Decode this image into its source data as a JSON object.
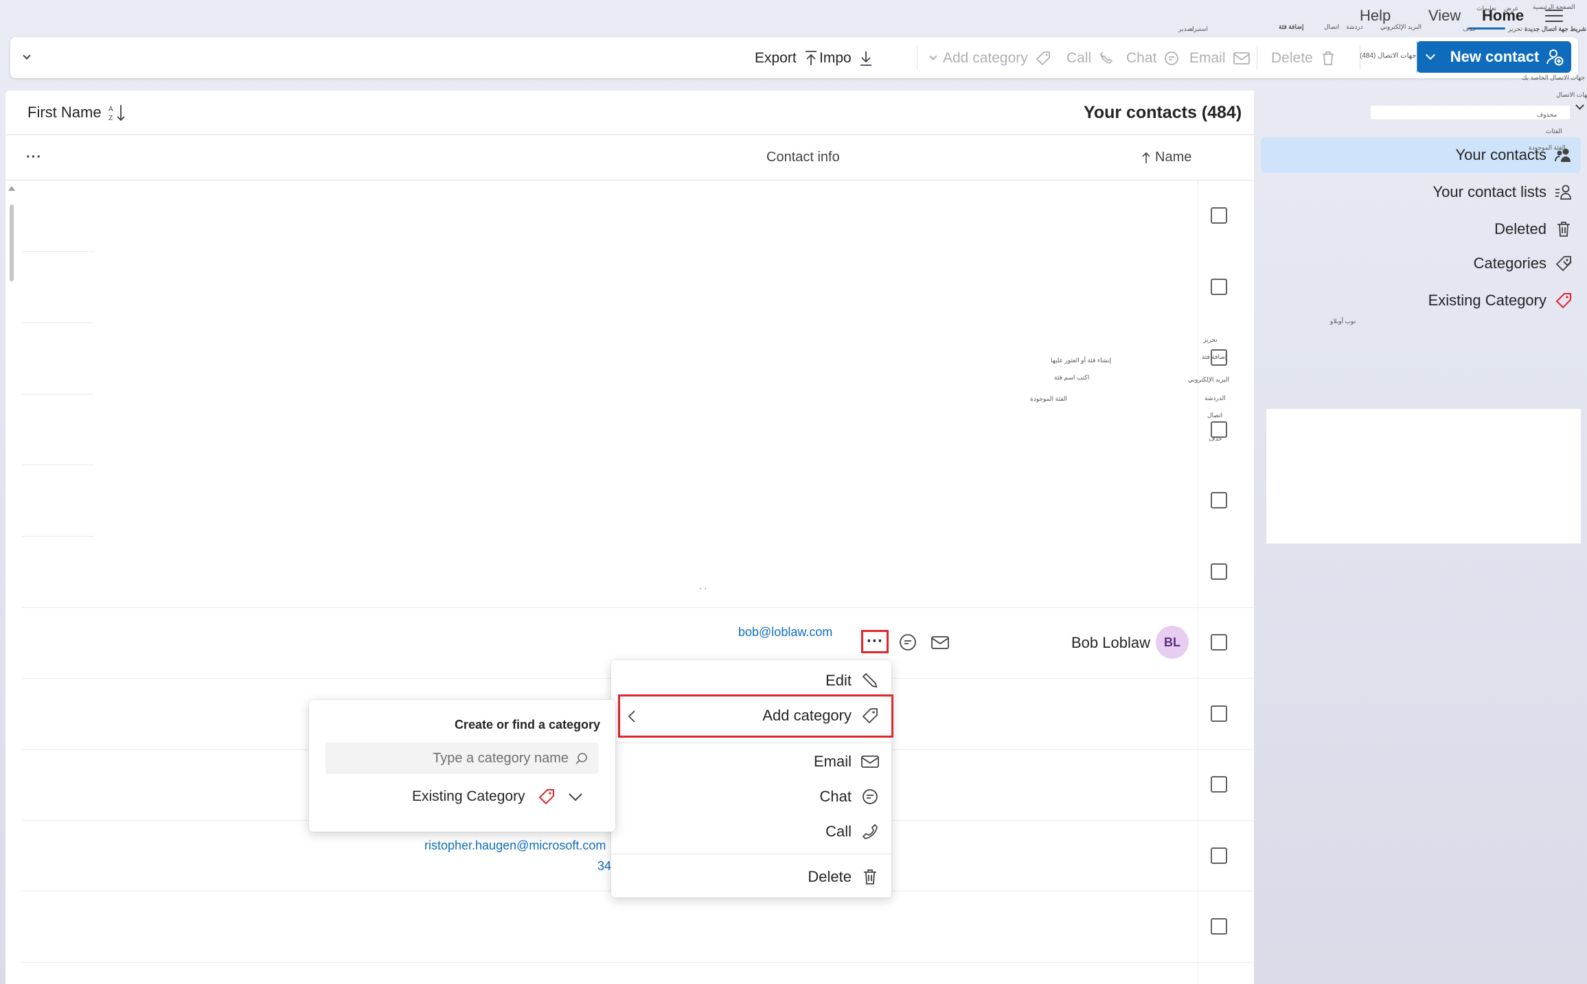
{
  "topbar": {
    "tabs": [
      {
        "label": "Home",
        "active": true
      },
      {
        "label": "View",
        "active": false
      },
      {
        "label": "Help",
        "active": false
      }
    ],
    "overlay_labels": [
      "الصفحة الرئيسية",
      "عرض",
      "تعليمات",
      "شريط جهة اتصال جديدة",
      "إضافة فئة",
      "البريد الإلكتروني",
      "دردشة",
      "اتصال",
      "استيراد",
      "تصدير",
      "تحرير",
      "حذف"
    ]
  },
  "ribbon": {
    "new_contact": "New contact",
    "contact_count_fragment": "جهات الاتصال (484)",
    "delete": "Delete",
    "email": "Email",
    "chat": "Chat",
    "call": "Call",
    "add_category": "Add category",
    "import": "Impo",
    "export": "Export"
  },
  "nav": {
    "overlay_labels": [
      "قوائم جهات الاتصال",
      "جهات الاتصال الخاصة بك",
      "محذوف",
      "الفئات",
      "الفئة الموجودة"
    ],
    "items": [
      {
        "label": "Your contacts",
        "selected": true,
        "icon": "people-icon"
      },
      {
        "label": "Your contact lists",
        "selected": false,
        "icon": "contact-list-icon"
      },
      {
        "label": "Deleted",
        "selected": false,
        "icon": "trash-icon"
      },
      {
        "label": "Categories",
        "selected": false,
        "icon": "tag-icon"
      },
      {
        "label": "Existing Category",
        "selected": false,
        "icon": "red-tag-icon"
      }
    ],
    "placeholder_label": "نوب أوبلاو"
  },
  "list": {
    "title": "Your contacts (484)",
    "sort_label": "First Name",
    "columns": {
      "name": "Name",
      "contact_info": "Contact info",
      "more": "···"
    },
    "overlay_labels": [
      "تحرير",
      "إضافة فئة",
      "البريد الإلكتروني",
      "الدردشة",
      "اتصال",
      "حذف",
      "إنشاء فئة أو العثور عليها",
      "اكتب اسم فئة",
      "الفئة الموجودة"
    ],
    "contact": {
      "initials": "BL",
      "name": "Bob Loblaw",
      "email": "bob@loblaw.com"
    },
    "partial_email": "ristopher.haugen@microsoft.com",
    "partial_number": "34"
  },
  "context_menu": {
    "items": [
      {
        "label": "Edit",
        "icon": "pencil-icon"
      },
      {
        "label": "Add category",
        "icon": "tag-icon"
      },
      {
        "label": "Email",
        "icon": "mail-icon"
      },
      {
        "label": "Chat",
        "icon": "chat-icon"
      },
      {
        "label": "Call",
        "icon": "phone-icon"
      },
      {
        "label": "Delete",
        "icon": "trash-icon"
      }
    ]
  },
  "category_submenu": {
    "title": "Create or find a category",
    "search_placeholder": "Type a category name",
    "existing_label": "Existing Category"
  },
  "colors": {
    "accent": "#0f6cbd",
    "selected_nav": "#cfe4fa",
    "highlight_red": "#e3242b",
    "avatar_bg": "#e8cdf0",
    "category_red": "#e3242b"
  }
}
